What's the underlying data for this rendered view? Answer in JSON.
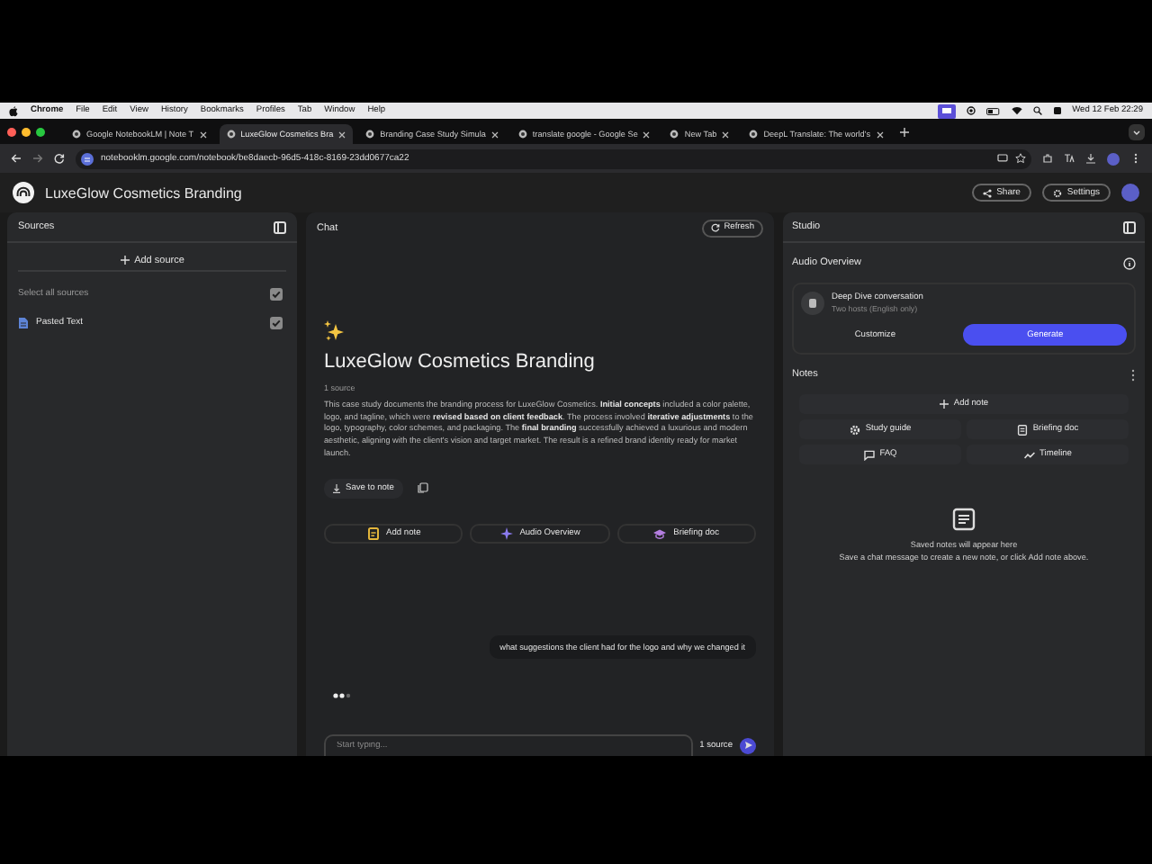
{
  "menu_bar": {
    "app": "Chrome",
    "menus": [
      "File",
      "Edit",
      "View",
      "History",
      "Bookmarks",
      "Profiles",
      "Tab",
      "Window",
      "Help"
    ],
    "clock": "Wed 12 Feb  22:29"
  },
  "tabs": [
    {
      "title": "Google NotebookLM | Note T",
      "selected": false
    },
    {
      "title": "LuxeGlow Cosmetics Bra",
      "selected": true
    },
    {
      "title": "Branding Case Study Simula",
      "selected": false
    },
    {
      "title": "translate google - Google Se",
      "selected": false
    },
    {
      "title": "New Tab",
      "selected": false
    },
    {
      "title": "DeepL Translate: The world's",
      "selected": false
    }
  ],
  "address_bar": {
    "url": "notebooklm.google.com/notebook/be8daecb-96d5-418c-8169-23dd0677ca22"
  },
  "app_header": {
    "title": "LuxeGlow Cosmetics Branding",
    "share": "Share",
    "settings": "Settings"
  },
  "sources": {
    "title": "Sources",
    "add": "Add source",
    "select_all": {
      "label": "Select all sources",
      "checked": true
    },
    "items": [
      {
        "name": "Pasted Text",
        "checked": true
      }
    ]
  },
  "chat": {
    "title": "Chat",
    "refresh": "Refresh",
    "notebook_title": "LuxeGlow Cosmetics Branding",
    "source_count": "1 source",
    "summary": "This case study documents the branding process for LuxeGlow Cosmetics. **Initial concepts** included a color palette, logo, and tagline, which were **revised based on client feedback**. The process involved **iterative adjustments** to the logo, typography, color schemes, and packaging. The **final branding** successfully achieved a luxurious and modern aesthetic, aligning with the client's vision and target market. The result is a refined brand identity ready for market launch.",
    "save": "Save to note",
    "actions": [
      {
        "kind": "note",
        "label": "Add note"
      },
      {
        "kind": "audio",
        "label": "Audio Overview"
      },
      {
        "kind": "briefing",
        "label": "Briefing doc"
      }
    ],
    "message": "what suggestions the client had for the logo and why we changed it",
    "input": {
      "placeholder": "Start typing...",
      "source_count": "1 source"
    }
  },
  "studio": {
    "title": "Studio",
    "audio_title": "Audio Overview",
    "conversation": {
      "title": "Deep Dive conversation",
      "subtitle": "Two hosts (English only)"
    },
    "customize": "Customize",
    "generate": "Generate",
    "notes_title": "Notes",
    "add_note": "Add note",
    "note_buttons": [
      {
        "kind": "study",
        "label": "Study guide"
      },
      {
        "kind": "briefing",
        "label": "Briefing doc"
      },
      {
        "kind": "faq",
        "label": "FAQ"
      },
      {
        "kind": "timeline",
        "label": "Timeline"
      }
    ],
    "empty_title": "Saved notes will appear here",
    "empty_text": "Save a chat message to create a new note, or click Add note above."
  }
}
